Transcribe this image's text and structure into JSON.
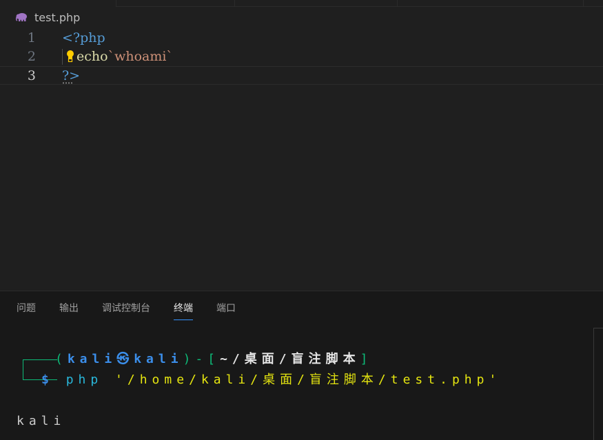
{
  "breadcrumb": {
    "file": "test.php",
    "icon": "php-elephant-icon"
  },
  "editor": {
    "lines": [
      {
        "num": "1",
        "tag_open": "<?php"
      },
      {
        "num": "2",
        "keyword": "echo",
        "string": "`whoami`"
      },
      {
        "num": "3",
        "tag_close": "?>"
      }
    ]
  },
  "panel": {
    "tabs": [
      "问题",
      "输出",
      "调试控制台",
      "终端",
      "端口"
    ],
    "active_tab": "终端"
  },
  "terminal": {
    "prompt_open": "(",
    "user": "kali",
    "at_symbol": "㉿",
    "host": "kali",
    "prompt_mid": ")-[",
    "path": "~/桌面/盲注脚本",
    "prompt_close": "]",
    "dollar": "$",
    "command": "php",
    "argument": "'/home/kali/桌面/盲注脚本/test.php'",
    "output": "kali"
  },
  "colors": {
    "editor_bg": "#1f1f1f",
    "panel_bg": "#181818",
    "accent": "#3794ff",
    "php_tag": "#569cd6",
    "string": "#ce9178",
    "terminal_green": "#0dbc79",
    "terminal_blue": "#3b8eea",
    "terminal_yellow": "#e5e510"
  }
}
